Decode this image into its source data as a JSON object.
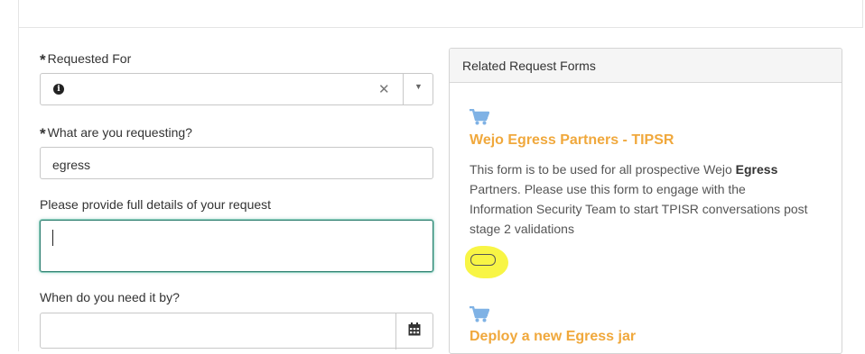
{
  "form": {
    "required_marker": "*",
    "requested_for": {
      "label": "Requested For",
      "value": ""
    },
    "what_requesting": {
      "label": "What are you requesting?",
      "value": "egress"
    },
    "details": {
      "label": "Please provide full details of your request",
      "value": ""
    },
    "need_by": {
      "label": "When do you need it by?",
      "value": ""
    }
  },
  "related": {
    "header": "Related Request Forms",
    "items": [
      {
        "title": "Wejo Egress Partners - TIPSR",
        "desc_before": "This form is to be used for all prospective Wejo ",
        "desc_bold": "Egress",
        "desc_after": " Partners. Please use this form to engage with the Information Security Team to start TPISR conversations post stage 2 validations"
      },
      {
        "title": "Deploy a new Egress jar"
      }
    ]
  },
  "colors": {
    "accent_orange": "#f0a83c",
    "focus_green": "#2e7f70",
    "cart_blue": "#7fb2e5",
    "highlight": "#f8f545"
  },
  "icons": [
    "info-icon",
    "clear-icon",
    "chevron-down-icon",
    "calendar-icon",
    "cart-icon"
  ]
}
